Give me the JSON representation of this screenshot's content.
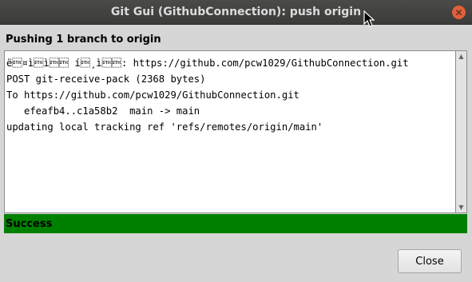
{
  "window": {
    "title": "Git Gui (GithubConnection): push origin"
  },
  "dialog": {
    "heading": "Pushing 1 branch to origin",
    "log_lines": [
      "ë\u0002¤ì\u0002ì\u0002\u0002 í\u0002¸ì\u0002\u0002: https://github.com/pcw1029/GithubConnection.git",
      "POST git-receive-pack (2368 bytes)",
      "To https://github.com/pcw1029/GithubConnection.git",
      "   efeafb4..c1a58b2  main -> main",
      "updating local tracking ref 'refs/remotes/origin/main'"
    ],
    "status": "Success",
    "status_color": "#008000",
    "close_label": "Close"
  },
  "icons": {
    "window_close": "close-icon",
    "cursor": "mouse-cursor-icon"
  }
}
